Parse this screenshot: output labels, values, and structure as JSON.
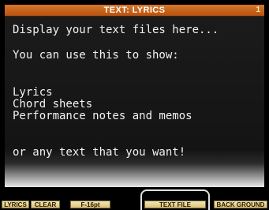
{
  "header": {
    "title": "TEXT: LYRICS",
    "page_number": "1"
  },
  "display": {
    "lines": [
      "Display your text files here...",
      "",
      "You can use this to show:",
      "",
      "Lyrics",
      "Chord sheets",
      "Performance notes and memos",
      "",
      "or any text that you want!"
    ]
  },
  "function_bar": {
    "lyrics_label": "LYRICS",
    "clear_label": "CLEAR",
    "font_size_label": "F-16pt",
    "text_file_label": "TEXT FILE",
    "background_label": "BACK GROUND"
  }
}
